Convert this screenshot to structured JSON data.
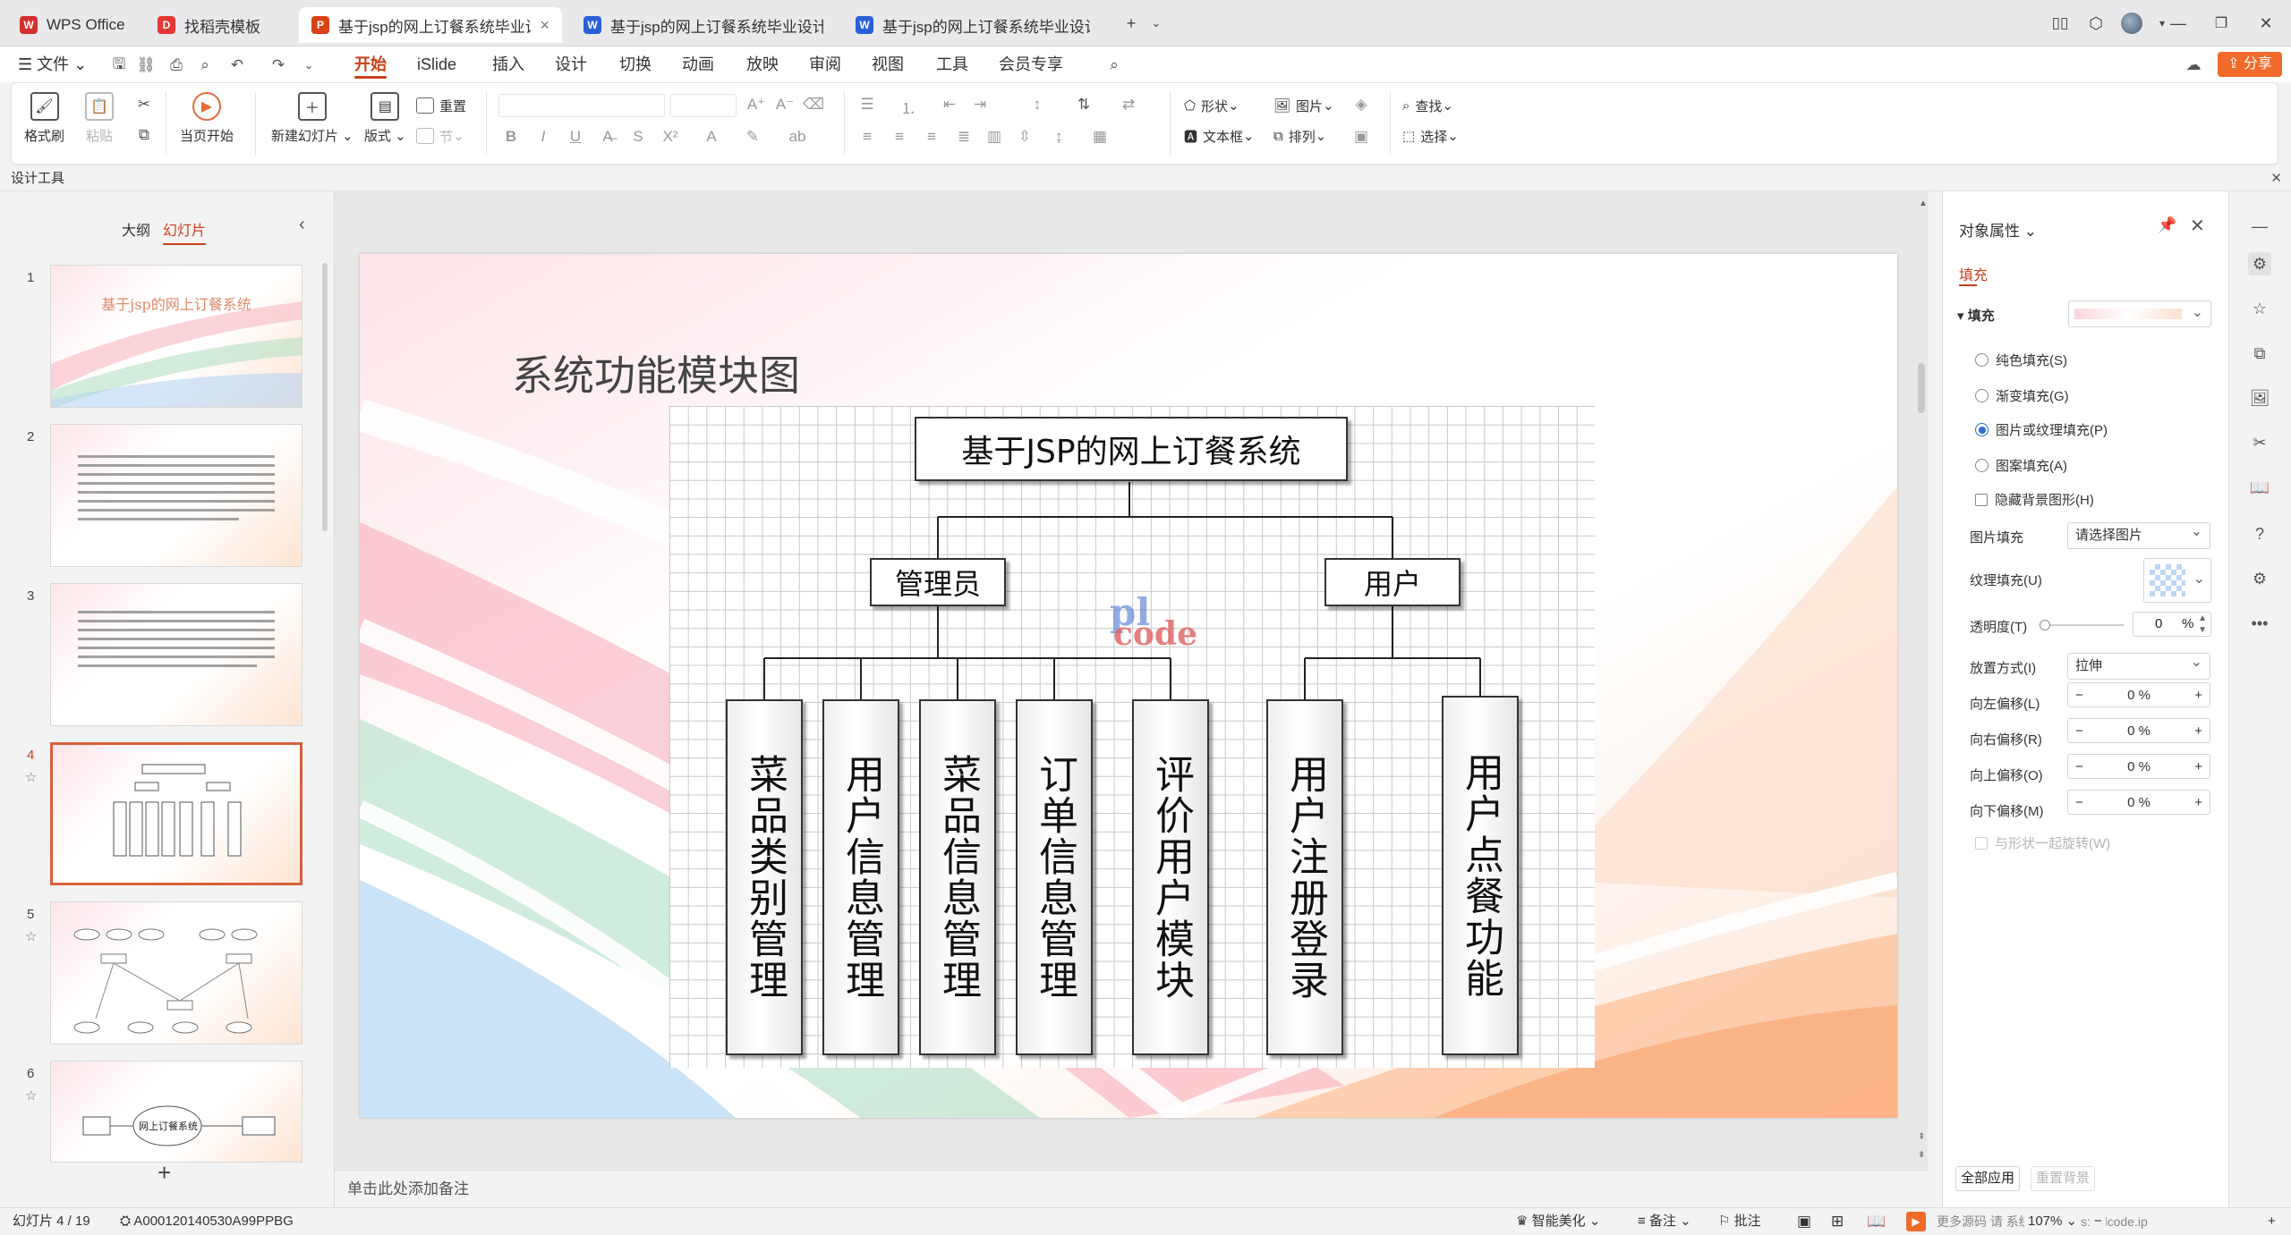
{
  "tabs": [
    {
      "label": "WPS Office",
      "icon_color": "#d32f2f",
      "icon_text": "W"
    },
    {
      "label": "找稻壳模板",
      "icon_color": "#e53935",
      "icon_text": "D"
    },
    {
      "label": "基于jsp的网上订餐系统毕业设计答",
      "icon_color": "#d84315",
      "icon_text": "P"
    },
    {
      "label": "基于jsp的网上订餐系统毕业设计论文",
      "icon_color": "#2b5fd9",
      "icon_text": "W"
    },
    {
      "label": "基于jsp的网上订餐系统毕业设计中期",
      "icon_color": "#2b5fd9",
      "icon_text": "W"
    }
  ],
  "menu": {
    "file": "文件",
    "items": [
      "开始",
      "iSlide",
      "插入",
      "设计",
      "切换",
      "动画",
      "放映",
      "审阅",
      "视图",
      "工具",
      "会员专享"
    ],
    "active": "开始",
    "share": "分享"
  },
  "ribbon": {
    "format_painter": "格式刷",
    "paste": "粘贴",
    "play_current": "当页开始",
    "new_slide": "新建幻灯片",
    "layout": "版式",
    "reset": "重置",
    "section": "节",
    "shape": "形状",
    "picture": "图片",
    "textbox": "文本框",
    "arrange": "排列",
    "find": "查找",
    "select": "选择"
  },
  "design_tools": "设计工具",
  "left_panel": {
    "tab_outline": "大纲",
    "tab_slides": "幻灯片",
    "slides": [
      {
        "num": "1",
        "title": "基于jsp的网上订餐系统"
      },
      {
        "num": "2",
        "title": ""
      },
      {
        "num": "3",
        "title": ""
      },
      {
        "num": "4",
        "title": ""
      },
      {
        "num": "5",
        "title": ""
      },
      {
        "num": "6",
        "title": "网上订餐系统"
      }
    ],
    "add": "+"
  },
  "slide": {
    "heading": "系统功能模块图",
    "root": "基于JSP的网上订餐系统",
    "admin": "管理员",
    "user": "用户",
    "admin_modules": [
      "菜品类别管理",
      "用户信息管理",
      "菜品信息管理",
      "订单信息管理",
      "评价用户模块"
    ],
    "user_modules": [
      "用户注册登录",
      "用户点餐功能"
    ],
    "watermark_top": "pl",
    "watermark_bottom": "code"
  },
  "notes_placeholder": "单击此处添加备注",
  "right_panel": {
    "title": "对象属性",
    "tab": "填充",
    "section": "填充",
    "options": [
      "纯色填充(S)",
      "渐变填充(G)",
      "图片或纹理填充(P)",
      "图案填充(A)"
    ],
    "hide_bg": "隐藏背景图形(H)",
    "picture_fill_label": "图片填充",
    "picture_fill_value": "请选择图片",
    "texture_label": "纹理填充(U)",
    "transparency_label": "透明度(T)",
    "transparency_value": "0",
    "transparency_unit": "%",
    "placement_label": "放置方式(I)",
    "placement_value": "拉伸",
    "offsets": [
      {
        "label": "向左偏移(L)",
        "value": "0",
        "unit": "%"
      },
      {
        "label": "向右偏移(R)",
        "value": "0",
        "unit": "%"
      },
      {
        "label": "向上偏移(O)",
        "value": "0",
        "unit": "%"
      },
      {
        "label": "向下偏移(M)",
        "value": "0",
        "unit": "%"
      }
    ],
    "rotate_with_shape": "与形状一起旋转(W)",
    "apply_all": "全部应用",
    "reset_bg": "重置背景"
  },
  "status": {
    "slide_pos": "幻灯片 4 / 19",
    "id": "A000120140530A99PPBG",
    "beautify": "智能美化",
    "notes": "备注",
    "comments": "批注",
    "zoom": "107%",
    "overlay": "更多源码 请 系统尽在 https://plcode.ip"
  },
  "colors": {
    "accent": "#c7411d",
    "share": "#f06a2a",
    "selection": "#d9603c"
  }
}
